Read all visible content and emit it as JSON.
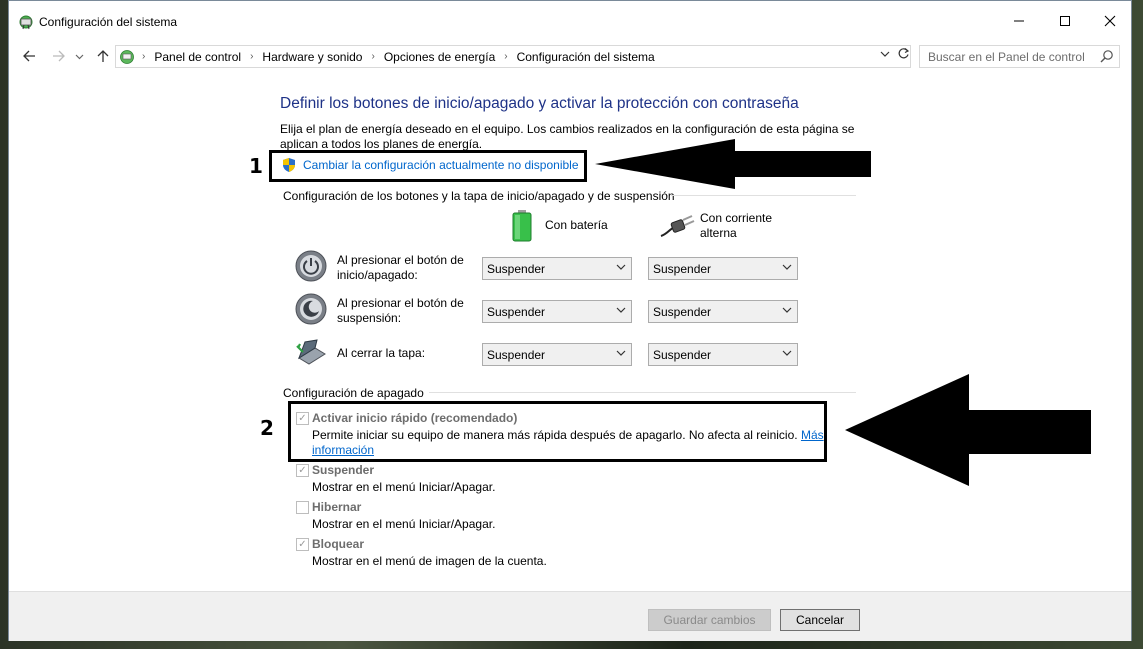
{
  "window": {
    "title": "Configuración del sistema",
    "controls": {
      "minimize": "–",
      "maximize": "☐",
      "close": "✕"
    }
  },
  "address": {
    "breadcrumbs": [
      "Panel de control",
      "Hardware y sonido",
      "Opciones de energía",
      "Configuración del sistema"
    ],
    "search_placeholder": "Buscar en el Panel de control"
  },
  "main": {
    "heading": "Definir los botones de inicio/apagado y activar la protección con contraseña",
    "description": "Elija el plan de energía deseado en el equipo. Los cambios realizados en la configuración de esta página se aplican a todos los planes de energía.",
    "change_settings_link": "Cambiar la configuración actualmente no disponible",
    "buttons_section": {
      "title": "Configuración de los botones y la tapa de inicio/apagado y de suspensión",
      "col_battery": "Con batería",
      "col_ac_line1": "Con corriente",
      "col_ac_line2": "alterna",
      "rows": [
        {
          "label_line1": "Al presionar el botón de",
          "label_line2": "inicio/apagado:",
          "battery": "Suspender",
          "ac": "Suspender",
          "icon": "power-button-icon"
        },
        {
          "label_line1": "Al presionar el botón de",
          "label_line2": "suspensión:",
          "battery": "Suspender",
          "ac": "Suspender",
          "icon": "sleep-button-icon"
        },
        {
          "label_line1": "Al cerrar la tapa:",
          "label_line2": "",
          "battery": "Suspender",
          "ac": "Suspender",
          "icon": "laptop-lid-icon"
        }
      ]
    },
    "shutdown_section": {
      "title": "Configuración de apagado",
      "items": [
        {
          "title": "Activar inicio rápido (recomendado)",
          "desc": "Permite iniciar su equipo de manera más rápida después de apagarlo. No afecta al reinicio.",
          "link_part1": "Más",
          "link_part2": "información",
          "checked": true
        },
        {
          "title": "Suspender",
          "desc": "Mostrar en el menú Iniciar/Apagar.",
          "checked": true
        },
        {
          "title": "Hibernar",
          "desc": "Mostrar en el menú Iniciar/Apagar.",
          "checked": false
        },
        {
          "title": "Bloquear",
          "desc": "Mostrar en el menú de imagen de la cuenta.",
          "checked": true
        }
      ]
    }
  },
  "annotations": {
    "marker1": "1",
    "marker2": "2"
  },
  "footer": {
    "save_label": "Guardar cambios",
    "cancel_label": "Cancelar"
  },
  "colors": {
    "heading": "#1e3287",
    "link": "#0066cc",
    "annotation": "#000000"
  }
}
